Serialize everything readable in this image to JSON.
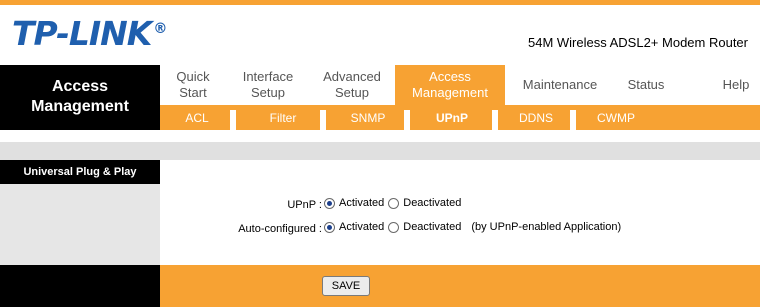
{
  "brand": {
    "logo": "TP-LINK",
    "reg_mark": "®",
    "model": "54M Wireless ADSL2+ Modem Router"
  },
  "section": {
    "title_line1": "Access",
    "title_line2": "Management"
  },
  "menu": [
    {
      "line1": "Quick",
      "line2": "Start"
    },
    {
      "line1": "Interface",
      "line2": "Setup"
    },
    {
      "line1": "Advanced",
      "line2": "Setup"
    },
    {
      "line1": "Access",
      "line2": "Management"
    },
    {
      "line1": "Maintenance",
      "line2": ""
    },
    {
      "line1": "Status",
      "line2": ""
    },
    {
      "line1": "Help",
      "line2": ""
    }
  ],
  "submenu": [
    "ACL",
    "Filter",
    "SNMP",
    "UPnP",
    "DDNS",
    "CWMP"
  ],
  "panel": {
    "title": "Universal Plug & Play"
  },
  "upnp": {
    "label": "UPnP :",
    "opt_on": "Activated",
    "opt_off": "Deactivated",
    "selected": "Activated"
  },
  "autoconf": {
    "label": "Auto-configured :",
    "opt_on": "Activated",
    "opt_off": "Deactivated",
    "note": "(by UPnP-enabled Application)",
    "selected": "Activated"
  },
  "buttons": {
    "save": "SAVE"
  },
  "colors": {
    "accent": "#f7a233",
    "brand_blue": "#1f5fae",
    "dark": "#000000"
  }
}
